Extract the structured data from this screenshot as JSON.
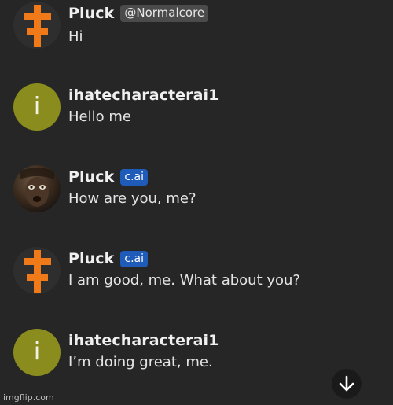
{
  "messages": [
    {
      "avatar_icon": "orange-cross-avatar-icon",
      "name": "Pluck",
      "badge": "@Normalcore",
      "text": "Hi"
    },
    {
      "avatar_letter": "i",
      "name": "ihatecharacterai1",
      "badge": "",
      "text": "Hello me"
    },
    {
      "avatar_icon": "portrait-photo-avatar",
      "name": "Pluck",
      "badge": "c.ai",
      "text": "How are you, me?"
    },
    {
      "avatar_icon": "orange-cross-avatar-icon",
      "name": "Pluck",
      "badge": "c.ai",
      "text": "I am good, me. What about you?"
    },
    {
      "avatar_letter": "i",
      "name": "ihatecharacterai1",
      "badge": "",
      "text": "I’m doing great, me."
    }
  ],
  "scroll_button": {
    "icon": "arrow-down-icon"
  },
  "watermark": "imgflip.com",
  "colors": {
    "background": "#262626",
    "cross_orange": "#f07a1a",
    "letter_avatar": "#8a8d1e",
    "cai_badge": "#1f5bb8",
    "handle_badge": "#4b4b4b"
  }
}
